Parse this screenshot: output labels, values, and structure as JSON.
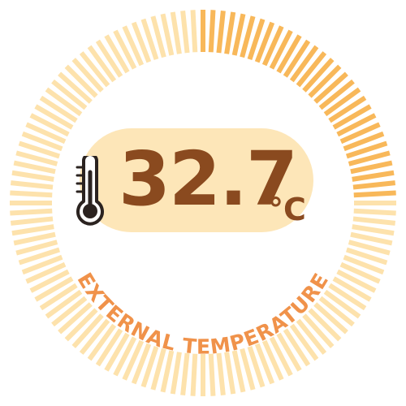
{
  "gauge": {
    "value_text": "32.7",
    "unit": "°C",
    "label": "EXTERNAL TEMPERATURE",
    "fill_fraction": 0.25,
    "colors": {
      "active_tick": "#f8b85a",
      "inactive_tick": "#fde2ac",
      "pill_background": "#fde6b8",
      "value_text": "#8a4a1f",
      "label_text": "#f0924a",
      "icon_stroke": "#2b2320"
    }
  },
  "icons": {
    "thermometer": "thermometer-icon"
  }
}
